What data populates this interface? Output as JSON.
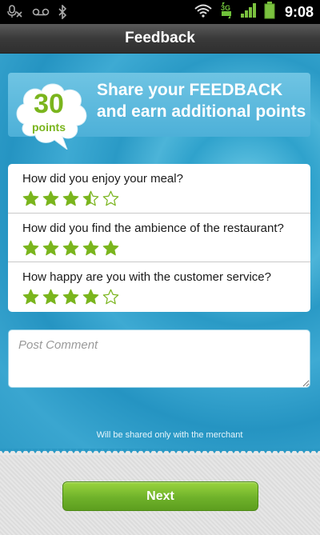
{
  "status_bar": {
    "time": "9:08",
    "network_label": "3G",
    "icons": [
      "mute-icon",
      "voicemail-icon",
      "bluetooth-icon",
      "wifi-icon",
      "network-3g-icon",
      "signal-icon",
      "battery-icon"
    ]
  },
  "header": {
    "title": "Feedback"
  },
  "banner": {
    "points_value": "30",
    "points_label": "points",
    "text": "Share your FEEDBACK and earn additional points"
  },
  "questions": [
    {
      "text": "How did you enjoy your meal?",
      "rating": 3.5,
      "max": 5
    },
    {
      "text": "How did you find the ambience of the restaurant?",
      "rating": 5,
      "max": 5
    },
    {
      "text": "How happy are you with the customer service?",
      "rating": 4,
      "max": 5
    }
  ],
  "comment": {
    "placeholder": "Post Comment",
    "value": ""
  },
  "note": "Will be shared only with the merchant",
  "next_label": "Next",
  "colors": {
    "star_green": "#7ab51d",
    "background_blue": "#2fa2cc",
    "button_green": "#6fb22a"
  }
}
